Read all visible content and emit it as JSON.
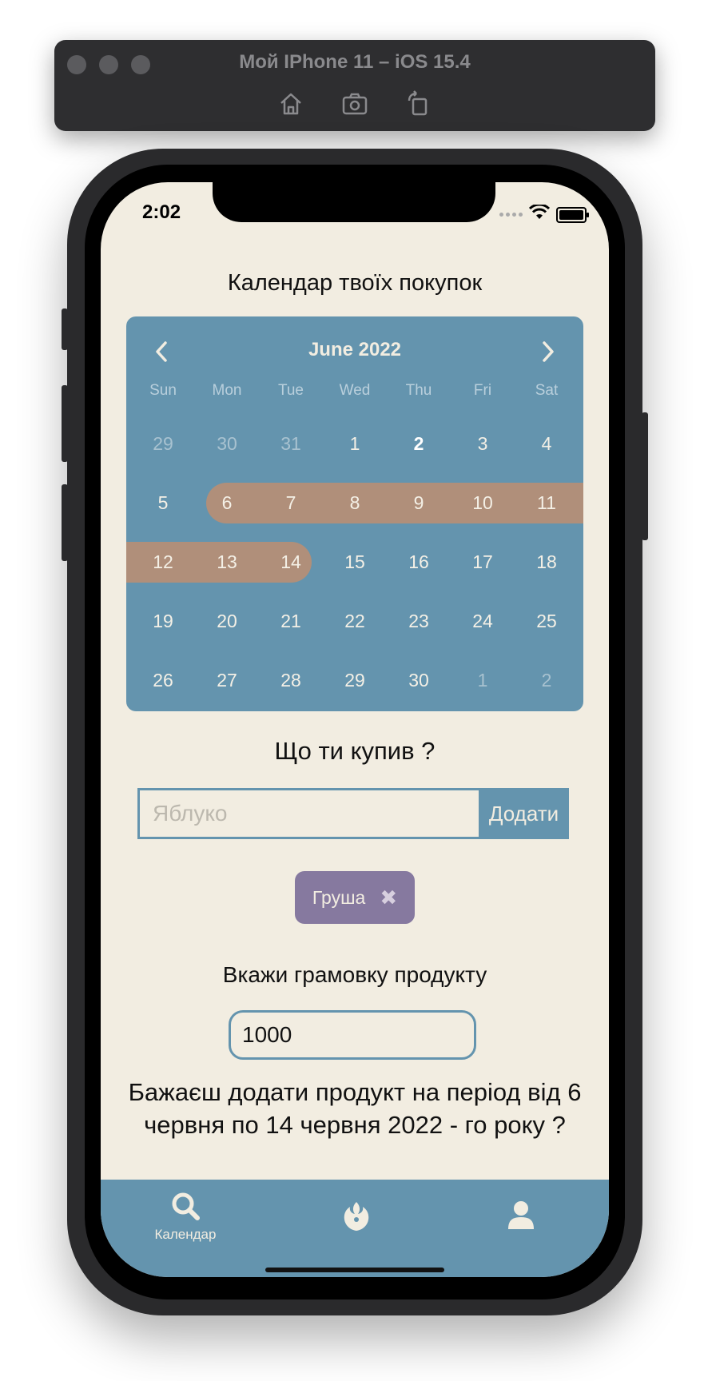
{
  "simulator": {
    "title": "Мой IPhone 11 – iOS 15.4",
    "icons": [
      "home-icon",
      "screenshot-icon",
      "rotate-icon"
    ]
  },
  "status_bar": {
    "time": "2:02"
  },
  "page": {
    "title": "Календар твоїх покупок"
  },
  "calendar": {
    "month": "June 2022",
    "weekdays": [
      "Sun",
      "Mon",
      "Tue",
      "Wed",
      "Thu",
      "Fri",
      "Sat"
    ],
    "weeks": [
      [
        "29",
        "30",
        "31",
        "1",
        "2",
        "3",
        "4"
      ],
      [
        "5",
        "6",
        "7",
        "8",
        "9",
        "10",
        "11"
      ],
      [
        "12",
        "13",
        "14",
        "15",
        "16",
        "17",
        "18"
      ],
      [
        "19",
        "20",
        "21",
        "22",
        "23",
        "24",
        "25"
      ],
      [
        "26",
        "27",
        "28",
        "29",
        "30",
        "1",
        "2"
      ]
    ],
    "today": "2",
    "selected_range": {
      "start": "6",
      "end": "14"
    }
  },
  "purchase": {
    "question": "Що ти купив ?",
    "input_placeholder": "Яблуко",
    "input_value": "",
    "add_label": "Додати",
    "chips": [
      {
        "label": "Груша"
      }
    ]
  },
  "weight": {
    "label": "Вкажи грамовку продукту",
    "value": "1000"
  },
  "confirm": {
    "text": "Бажаєш додати продукт на період від 6 червня по 14 червня 2022 - го року ?"
  },
  "tabbar": {
    "items": [
      {
        "label": "Календар",
        "icon": "search-icon"
      },
      {
        "label": "",
        "icon": "rebel-alliance-icon"
      },
      {
        "label": "",
        "icon": "user-icon"
      }
    ]
  },
  "colors": {
    "accent": "#6494ae",
    "background": "#f2ede1",
    "range": "#b08f7a",
    "chip": "#86799f"
  }
}
